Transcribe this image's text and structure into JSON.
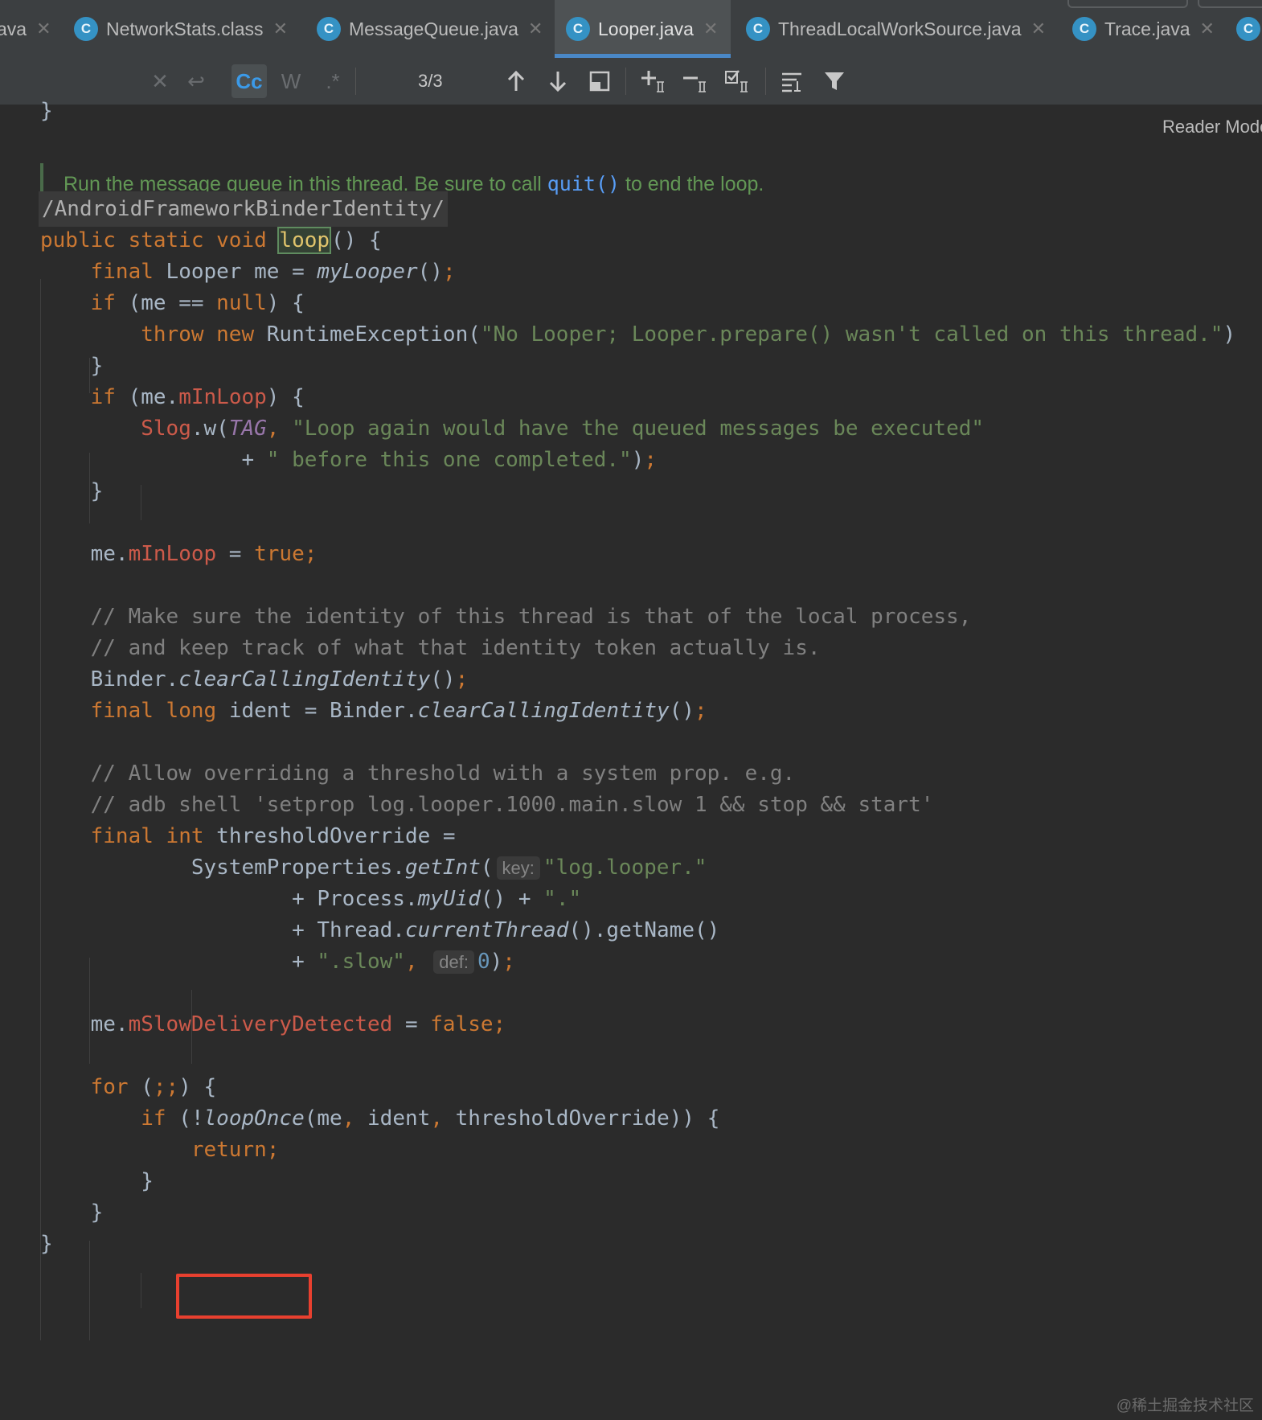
{
  "tabs": [
    {
      "label": "ava",
      "active": false
    },
    {
      "label": "NetworkStats.class",
      "active": false
    },
    {
      "label": "MessageQueue.java",
      "active": false
    },
    {
      "label": "Looper.java",
      "active": true
    },
    {
      "label": "ThreadLocalWorkSource.java",
      "active": false
    },
    {
      "label": "Trace.java",
      "active": false
    }
  ],
  "tab_icon_letter": "C",
  "search": {
    "case_label": "Cc",
    "words_label": "W",
    "regex_label": ".*",
    "match_counter": "3/3"
  },
  "editor": {
    "reader_mode": "Reader Mode",
    "doc_comment": {
      "before": "Run the message queue in this thread. Be sure to call ",
      "link": "quit()",
      "after": " to end the loop."
    },
    "annotation": "/AndroidFrameworkBinderIdentity/",
    "inlay_key": "key:",
    "inlay_def": "def:"
  },
  "watermark": "@稀土掘金技术社区",
  "colors": {
    "keyword": "#cc7832",
    "string": "#6a8759",
    "comment": "#808080",
    "field": "#cc5a4a",
    "doc": "#629755",
    "highlight_box": "#e8402f"
  }
}
